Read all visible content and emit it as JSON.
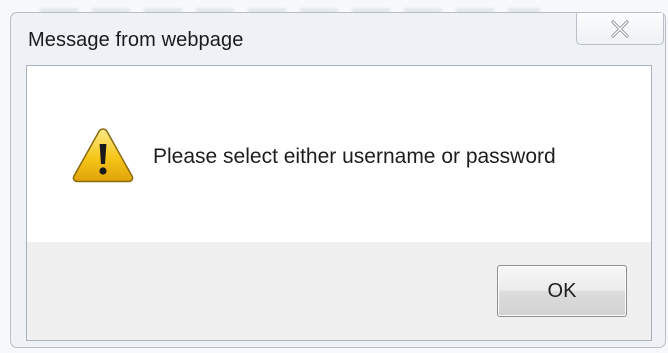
{
  "dialog": {
    "title": "Message from webpage",
    "close_icon": "close-x-icon",
    "message_icon": "warning-icon",
    "message": "Please select either username or password",
    "ok_label": "OK"
  },
  "colors": {
    "warning_fill": "#f5c518",
    "warning_border": "#8a6a10",
    "content_bg": "#ffffff",
    "button_bar_bg": "#f0f0f0"
  }
}
